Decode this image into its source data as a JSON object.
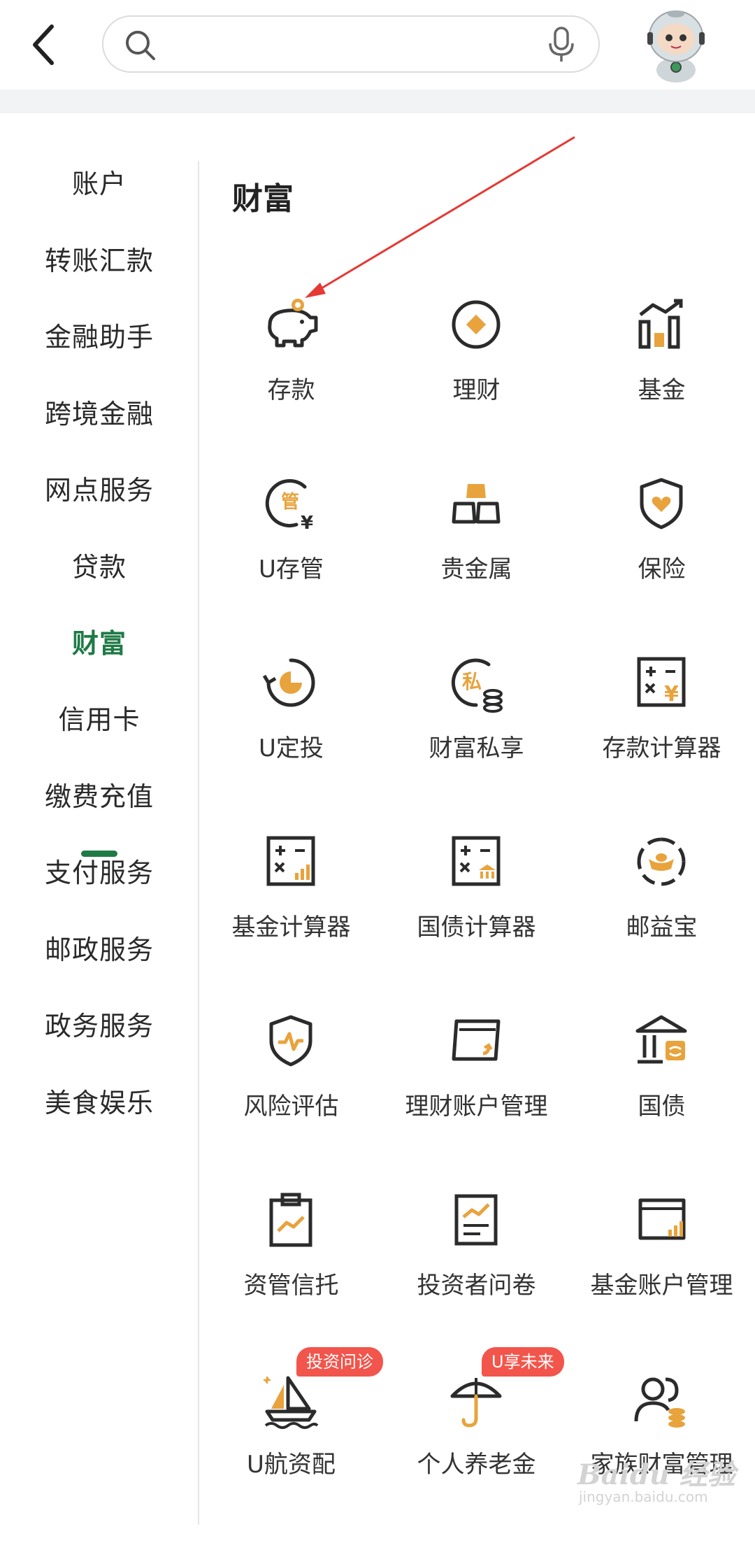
{
  "search": {
    "placeholder": ""
  },
  "sidebar": {
    "items": [
      {
        "label": "账户"
      },
      {
        "label": "转账汇款"
      },
      {
        "label": "金融助手"
      },
      {
        "label": "跨境金融"
      },
      {
        "label": "网点服务"
      },
      {
        "label": "贷款"
      },
      {
        "label": "财富"
      },
      {
        "label": "信用卡"
      },
      {
        "label": "缴费充值"
      },
      {
        "label": "支付服务"
      },
      {
        "label": "邮政服务"
      },
      {
        "label": "政务服务"
      },
      {
        "label": "美食娱乐"
      }
    ],
    "active_index": 6
  },
  "main": {
    "title": "财富",
    "tiles": [
      {
        "label": "存款",
        "icon": "piggy-bank-icon"
      },
      {
        "label": "理财",
        "icon": "diamond-coin-icon"
      },
      {
        "label": "基金",
        "icon": "bar-chart-icon"
      },
      {
        "label": "U存管",
        "icon": "custody-icon"
      },
      {
        "label": "贵金属",
        "icon": "gold-bars-icon"
      },
      {
        "label": "保险",
        "icon": "shield-heart-icon"
      },
      {
        "label": "U定投",
        "icon": "pie-cycle-icon"
      },
      {
        "label": "财富私享",
        "icon": "private-coins-icon"
      },
      {
        "label": "存款计算器",
        "icon": "calculator-yen-icon"
      },
      {
        "label": "基金计算器",
        "icon": "calculator-chart-icon"
      },
      {
        "label": "国债计算器",
        "icon": "calculator-bank-icon"
      },
      {
        "label": "邮益宝",
        "icon": "ingot-cycle-icon"
      },
      {
        "label": "风险评估",
        "icon": "shield-pulse-icon"
      },
      {
        "label": "理财账户管理",
        "icon": "account-card-icon"
      },
      {
        "label": "国债",
        "icon": "bank-building-icon"
      },
      {
        "label": "资管信托",
        "icon": "clipboard-trend-icon"
      },
      {
        "label": "投资者问卷",
        "icon": "document-chart-icon"
      },
      {
        "label": "基金账户管理",
        "icon": "card-chart-icon"
      },
      {
        "label": "U航资配",
        "icon": "sailboat-icon",
        "badge": "投资问诊"
      },
      {
        "label": "个人养老金",
        "icon": "umbrella-icon",
        "badge": "U享未来"
      },
      {
        "label": "家族财富管理",
        "icon": "family-coins-icon"
      }
    ]
  },
  "colors": {
    "accent_green": "#1f7a45",
    "icon_dark": "#2b2b2b",
    "icon_gold": "#e8a33d",
    "badge_red": "#f2554b",
    "arrow_red": "#e53935"
  },
  "watermark": {
    "brand": "Baidu 经验",
    "url": "jingyan.baidu.com"
  }
}
